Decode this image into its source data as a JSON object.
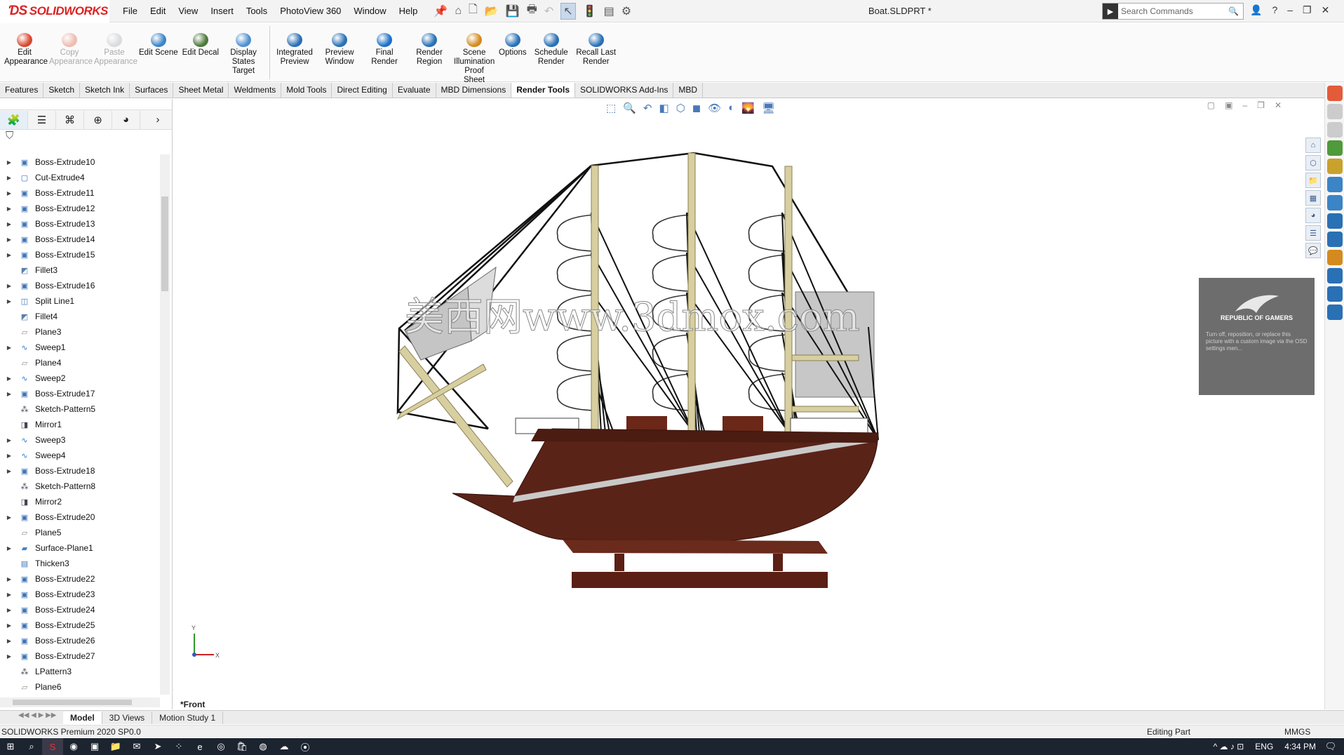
{
  "app": {
    "brand": "SOLIDWORKS",
    "document_title": "Boat.SLDPRT *"
  },
  "menu": [
    "File",
    "Edit",
    "View",
    "Insert",
    "Tools",
    "PhotoView 360",
    "Window",
    "Help"
  ],
  "search": {
    "placeholder": "Search Commands"
  },
  "ribbon": [
    {
      "label": "Edit Appearance",
      "enabled": true,
      "color": "#d9482f"
    },
    {
      "label": "Copy Appearance",
      "enabled": false,
      "color": "#d9482f"
    },
    {
      "label": "Paste Appearance",
      "enabled": false,
      "color": "#9aa4ad"
    },
    {
      "label": "Edit Scene",
      "enabled": true,
      "color": "#3b84c6"
    },
    {
      "label": "Edit Decal",
      "enabled": true,
      "color": "#4b7a3a"
    },
    {
      "label": "Display States Target",
      "enabled": true,
      "color": "#4f8fd0"
    },
    {
      "label": "Integrated Preview",
      "enabled": true,
      "color": "#2a70b5"
    },
    {
      "label": "Preview Window",
      "enabled": true,
      "color": "#2a70b5"
    },
    {
      "label": "Final Render",
      "enabled": true,
      "color": "#1e6fc7"
    },
    {
      "label": "Render Region",
      "enabled": true,
      "color": "#2a70b5"
    },
    {
      "label": "Scene Illumination Proof Sheet",
      "enabled": true,
      "color": "#d48a1e"
    },
    {
      "label": "Options",
      "enabled": true,
      "color": "#2a70b5"
    },
    {
      "label": "Schedule Render",
      "enabled": true,
      "color": "#2a70b5"
    },
    {
      "label": "Recall Last Render",
      "enabled": true,
      "color": "#2a70b5"
    }
  ],
  "tabs": [
    "Features",
    "Sketch",
    "Sketch Ink",
    "Surfaces",
    "Sheet Metal",
    "Weldments",
    "Mold Tools",
    "Direct Editing",
    "Evaluate",
    "MBD Dimensions",
    "Render Tools",
    "SOLIDWORKS Add-Ins",
    "MBD"
  ],
  "active_tab": "Render Tools",
  "feature_tree": [
    {
      "name": "Boss-Extrude10",
      "type": "extrude",
      "expandable": true
    },
    {
      "name": "Cut-Extrude4",
      "type": "cut",
      "expandable": true
    },
    {
      "name": "Boss-Extrude11",
      "type": "extrude",
      "expandable": true
    },
    {
      "name": "Boss-Extrude12",
      "type": "extrude",
      "expandable": true
    },
    {
      "name": "Boss-Extrude13",
      "type": "extrude",
      "expandable": true
    },
    {
      "name": "Boss-Extrude14",
      "type": "extrude",
      "expandable": true
    },
    {
      "name": "Boss-Extrude15",
      "type": "extrude",
      "expandable": true
    },
    {
      "name": "Fillet3",
      "type": "fillet",
      "expandable": false
    },
    {
      "name": "Boss-Extrude16",
      "type": "extrude",
      "expandable": true
    },
    {
      "name": "Split Line1",
      "type": "split",
      "expandable": true
    },
    {
      "name": "Fillet4",
      "type": "fillet",
      "expandable": false
    },
    {
      "name": "Plane3",
      "type": "plane",
      "expandable": false
    },
    {
      "name": "Sweep1",
      "type": "sweep",
      "expandable": true
    },
    {
      "name": "Plane4",
      "type": "plane",
      "expandable": false
    },
    {
      "name": "Sweep2",
      "type": "sweep",
      "expandable": true
    },
    {
      "name": "Boss-Extrude17",
      "type": "extrude",
      "expandable": true
    },
    {
      "name": "Sketch-Pattern5",
      "type": "pattern",
      "expandable": false
    },
    {
      "name": "Mirror1",
      "type": "mirror",
      "expandable": false
    },
    {
      "name": "Sweep3",
      "type": "sweep",
      "expandable": true
    },
    {
      "name": "Sweep4",
      "type": "sweep",
      "expandable": true
    },
    {
      "name": "Boss-Extrude18",
      "type": "extrude",
      "expandable": true
    },
    {
      "name": "Sketch-Pattern8",
      "type": "pattern",
      "expandable": false
    },
    {
      "name": "Mirror2",
      "type": "mirror",
      "expandable": false
    },
    {
      "name": "Boss-Extrude20",
      "type": "extrude",
      "expandable": true
    },
    {
      "name": "Plane5",
      "type": "plane",
      "expandable": false
    },
    {
      "name": "Surface-Plane1",
      "type": "surface",
      "expandable": true
    },
    {
      "name": "Thicken3",
      "type": "thicken",
      "expandable": false
    },
    {
      "name": "Boss-Extrude22",
      "type": "extrude",
      "expandable": true
    },
    {
      "name": "Boss-Extrude23",
      "type": "extrude",
      "expandable": true
    },
    {
      "name": "Boss-Extrude24",
      "type": "extrude",
      "expandable": true
    },
    {
      "name": "Boss-Extrude25",
      "type": "extrude",
      "expandable": true
    },
    {
      "name": "Boss-Extrude26",
      "type": "extrude",
      "expandable": true
    },
    {
      "name": "Boss-Extrude27",
      "type": "extrude",
      "expandable": true
    },
    {
      "name": "LPattern3",
      "type": "pattern",
      "expandable": false
    },
    {
      "name": "Plane6",
      "type": "plane",
      "expandable": false
    }
  ],
  "viewport": {
    "view_name": "*Front",
    "watermark": "美西网www.3dmox.com",
    "triad": {
      "x": "X",
      "y": "Y"
    },
    "rog_card": {
      "brand": "REPUBLIC OF GAMERS",
      "message": "Turn off, reposition, or replace this picture with a custom image via the OSD settings men..."
    }
  },
  "bottom_tabs": [
    "Model",
    "3D Views",
    "Motion Study 1"
  ],
  "active_bottom_tab": "Model",
  "status": {
    "product": "SOLIDWORKS Premium 2020 SP0.0",
    "mode": "Editing Part",
    "units": "MMGS"
  },
  "taskbar": {
    "lang": "ENG",
    "time": "4:34 PM"
  },
  "colors": {
    "hull": "#5a2318",
    "mast": "#d8cfa0",
    "sail_gray": "#c8c8c8",
    "accent": "#d22222"
  }
}
